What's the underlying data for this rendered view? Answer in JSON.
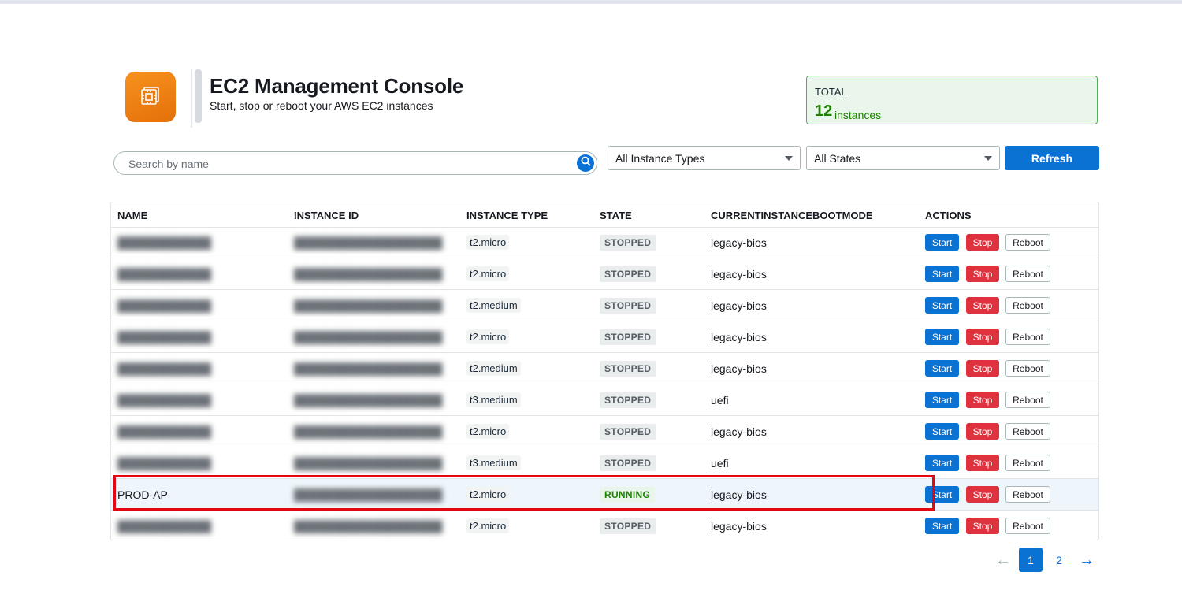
{
  "header": {
    "title": "EC2 Management Console",
    "subtitle": "Start, stop or reboot your AWS EC2 instances",
    "logo_icon": "chip-icon",
    "brand_color": "#f7921e"
  },
  "summary": {
    "label": "TOTAL",
    "count": "12",
    "unit": "instances"
  },
  "toolbar": {
    "search_placeholder": "Search by name",
    "type_filter": "All Instance Types",
    "state_filter": "All States",
    "refresh_label": "Refresh"
  },
  "table": {
    "columns": [
      "NAME",
      "INSTANCE ID",
      "INSTANCE TYPE",
      "STATE",
      "CURRENTINSTANCEBOOTMODE",
      "ACTIONS"
    ],
    "rows": [
      {
        "name": "blurred-name",
        "id": "blurred-instance-id",
        "type": "t2.micro",
        "state": "STOPPED",
        "boot": "legacy-bios"
      },
      {
        "name": "blurred-name",
        "id": "blurred-instance-id",
        "type": "t2.micro",
        "state": "STOPPED",
        "boot": "legacy-bios"
      },
      {
        "name": "blurred-name",
        "id": "blurred-instance-id",
        "type": "t2.medium",
        "state": "STOPPED",
        "boot": "legacy-bios"
      },
      {
        "name": "blurred-name",
        "id": "blurred-instance-id",
        "type": "t2.micro",
        "state": "STOPPED",
        "boot": "legacy-bios"
      },
      {
        "name": "blurred-name",
        "id": "blurred-instance-id",
        "type": "t2.medium",
        "state": "STOPPED",
        "boot": "legacy-bios"
      },
      {
        "name": "blurred-name",
        "id": "blurred-instance-id",
        "type": "t3.medium",
        "state": "STOPPED",
        "boot": "uefi"
      },
      {
        "name": "blurred-name",
        "id": "blurred-instance-id",
        "type": "t2.micro",
        "state": "STOPPED",
        "boot": "legacy-bios"
      },
      {
        "name": "blurred-name",
        "id": "blurred-instance-id",
        "type": "t3.medium",
        "state": "STOPPED",
        "boot": "uefi"
      },
      {
        "name": "PROD-AP",
        "id": "blurred-instance-id",
        "type": "t2.micro",
        "state": "RUNNING",
        "boot": "legacy-bios"
      },
      {
        "name": "blurred-name",
        "id": "blurred-instance-id",
        "type": "t2.micro",
        "state": "STOPPED",
        "boot": "legacy-bios"
      }
    ],
    "actions": {
      "start": "Start",
      "stop": "Stop",
      "reboot": "Reboot"
    }
  },
  "pagination": {
    "pages": [
      "1",
      "2"
    ],
    "current": "1",
    "prev_icon": "arrow-left-icon",
    "next_icon": "arrow-right-icon"
  },
  "colors": {
    "primary": "#0972d3",
    "danger": "#e0313f",
    "success": "#1d8102",
    "highlight": "#e30613"
  }
}
